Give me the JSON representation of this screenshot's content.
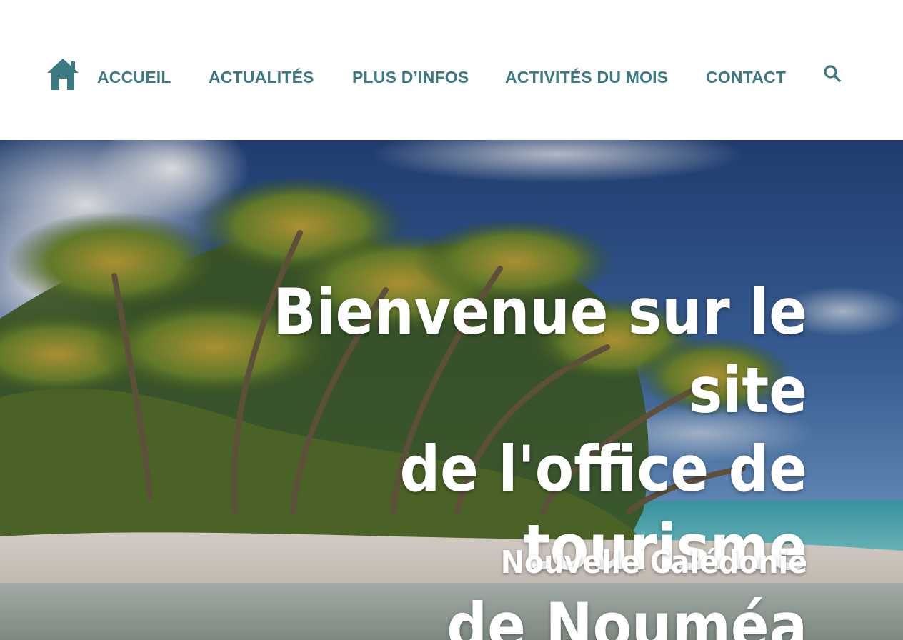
{
  "header": {
    "home_icon": "home-icon",
    "nav": [
      {
        "label": "ACCUEIL"
      },
      {
        "label": "ACTUALITÉS"
      },
      {
        "label": "PLUS D’INFOS"
      },
      {
        "label": "ACTIVITÉS DU MOIS"
      },
      {
        "label": "CONTACT"
      }
    ],
    "search_icon": "search-icon",
    "accent_color": "#3b7a83"
  },
  "hero": {
    "title_lines": [
      "Bienvenue sur le site",
      "de l'office de tourisme",
      "de Nouméa"
    ],
    "subtitle": "Nouvelle Calédonie",
    "background": "tropical beach with palm trees, sky and lagoon"
  }
}
